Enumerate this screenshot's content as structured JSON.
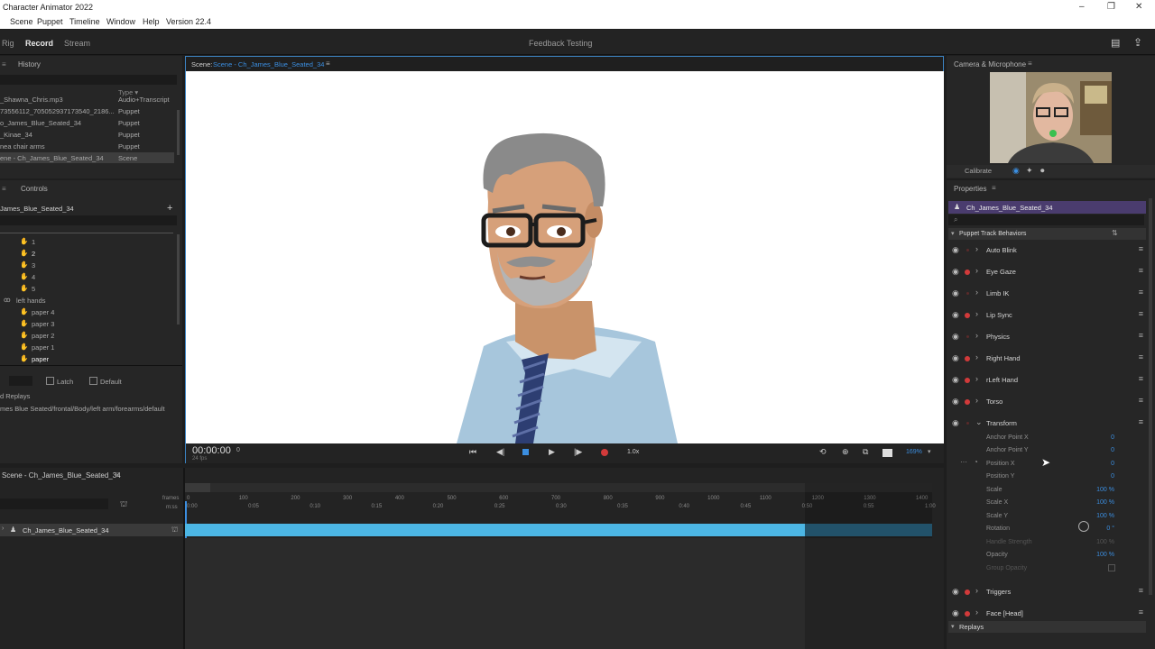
{
  "app": {
    "title": "Character Animator 2022",
    "menus": [
      "Scene",
      "Puppet",
      "Timeline",
      "Window",
      "Help",
      "Version 22.4"
    ],
    "window_controls": [
      "–",
      "❐",
      "✕"
    ]
  },
  "workspace": {
    "tabs": [
      "Rig",
      "Record",
      "Stream"
    ],
    "active_tab": "Record",
    "project_name": "Feedback Testing"
  },
  "project_panel": {
    "tab": "History",
    "type_header": "Type",
    "items": [
      {
        "name": "_Shawna_Chris.mp3",
        "type": "Audio+Transcript"
      },
      {
        "name": "73556112_705052937173540_2186...",
        "type": "Puppet"
      },
      {
        "name": "o_James_Blue_Seated_34",
        "type": "Puppet"
      },
      {
        "name": "_Kinae_34",
        "type": "Puppet"
      },
      {
        "name": "nea chair arms",
        "type": "Puppet"
      },
      {
        "name": "ene - Ch_James_Blue_Seated_34",
        "type": "Scene"
      }
    ]
  },
  "controls_panel": {
    "tab": "Controls",
    "puppet": "James_Blue_Seated_34",
    "add": "+",
    "handles": [
      "1",
      "2",
      "3",
      "4",
      "5"
    ],
    "group": "left hands",
    "papers": [
      "paper 4",
      "paper 3",
      "paper 2",
      "paper 1",
      "paper"
    ],
    "latch": "Latch",
    "default": "Default",
    "replays_label": "d Replays",
    "path": "mes Blue Seated/frontal/Body/left arm/forearms/default"
  },
  "scene": {
    "label": "Scene:",
    "name": "Scene - Ch_James_Blue_Seated_34",
    "menu": "≡",
    "timecode": "00:00:00",
    "frame": "0",
    "fps": "24 fps",
    "speed": "1.0x",
    "zoom": "169%"
  },
  "camera": {
    "title": "Camera & Microphone",
    "calibrate": "Calibrate"
  },
  "properties": {
    "title": "Properties",
    "puppet": "Ch_James_Blue_Seated_34",
    "section": "Puppet Track Behaviors",
    "behaviors_top": [
      {
        "name": "Auto Blink",
        "armed": false
      },
      {
        "name": "Eye Gaze",
        "armed": true
      },
      {
        "name": "Limb IK",
        "armed": false
      },
      {
        "name": "Lip Sync",
        "armed": true
      },
      {
        "name": "Physics",
        "armed": false
      },
      {
        "name": "Right Hand",
        "armed": true
      },
      {
        "name": "rLeft Hand",
        "armed": true
      },
      {
        "name": "Torso",
        "armed": true
      },
      {
        "name": "Transform",
        "armed": false
      }
    ],
    "transform_params": [
      {
        "name": "Anchor Point X",
        "value": "0"
      },
      {
        "name": "Anchor Point Y",
        "value": "0"
      },
      {
        "name": "Position X",
        "value": "0"
      },
      {
        "name": "Position Y",
        "value": "0"
      },
      {
        "name": "Scale",
        "value": "100 %"
      },
      {
        "name": "Scale X",
        "value": "100 %"
      },
      {
        "name": "Scale Y",
        "value": "100 %"
      },
      {
        "name": "Rotation",
        "value": "0 °"
      },
      {
        "name": "Handle Strength",
        "value": "100 %"
      },
      {
        "name": "Opacity",
        "value": "100 %"
      },
      {
        "name": "Group Opacity",
        "value": ""
      }
    ],
    "behaviors_bottom": [
      {
        "name": "Triggers",
        "armed": true
      },
      {
        "name": "Face [Head]",
        "armed": true
      }
    ],
    "replays": "Replays"
  },
  "timeline": {
    "title": "Scene - Ch_James_Blue_Seated_34",
    "frames_label": "frames",
    "ms_label": "m:ss",
    "frame_ticks": [
      "0",
      "100",
      "200",
      "300",
      "400",
      "500",
      "600",
      "700",
      "800",
      "900",
      "1000",
      "1100",
      "1200",
      "1300",
      "1400"
    ],
    "time_ticks": [
      "0:00",
      "0:05",
      "0:10",
      "0:15",
      "0:20",
      "0:25",
      "0:30",
      "0:35",
      "0:40",
      "0:45",
      "0:50",
      "0:55",
      "1:00"
    ],
    "track": "Ch_James_Blue_Seated_34",
    "track_fill": 0.83
  },
  "colors": {
    "accent": "#3b8ee0",
    "record": "#d23a3a",
    "track": "#4cb6e4",
    "puppet_header": "#4a3c6e"
  }
}
